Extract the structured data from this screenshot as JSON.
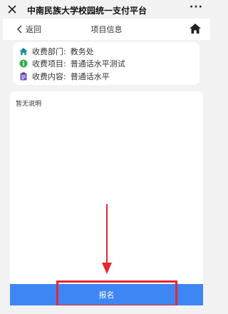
{
  "wechat_bar": {
    "title": "中南民族大学校园统一支付平台",
    "more": "···"
  },
  "nav": {
    "back_label": "返回",
    "title": "项目信息"
  },
  "info": {
    "department": {
      "label": "收费部门:",
      "value": "教务处"
    },
    "item": {
      "label": "收费项目:",
      "value": "普通话水平测试"
    },
    "content": {
      "label": "收费内容:",
      "value": "普通话水平"
    }
  },
  "description": "暂无说明",
  "signup_label": "报名",
  "colors": {
    "primary": "#3f86f5",
    "annotation": "#e8262f",
    "department_icon": "#1a8aa0",
    "item_icon": "#2fb24a",
    "content_icon": "#6b4fbf"
  }
}
